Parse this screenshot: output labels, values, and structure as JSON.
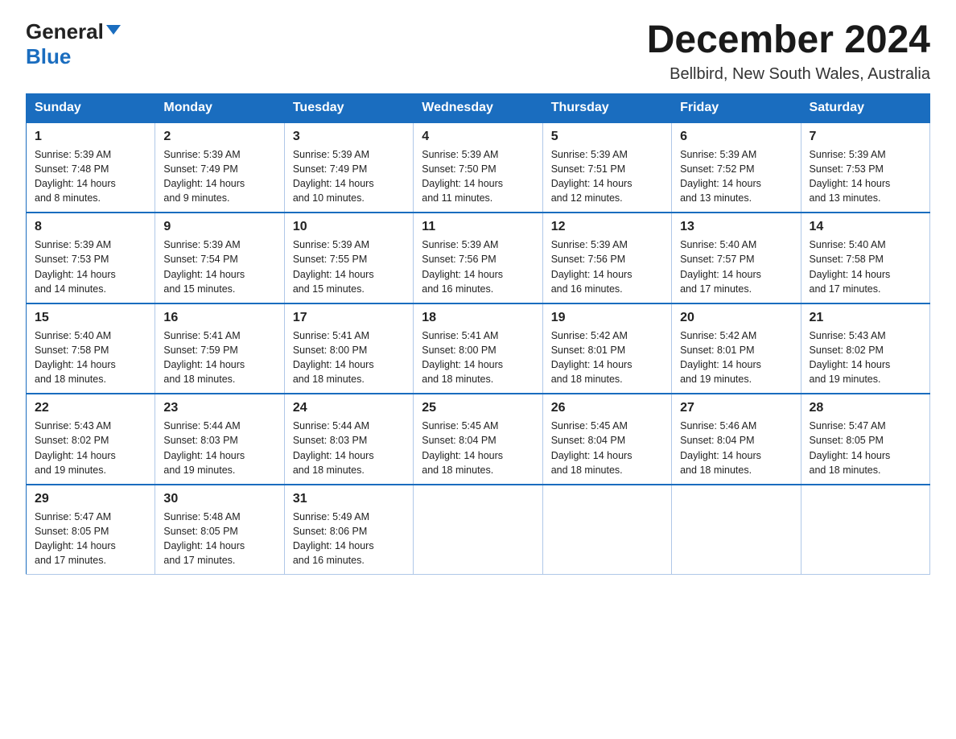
{
  "header": {
    "logo_general": "General",
    "logo_blue": "Blue",
    "title": "December 2024",
    "subtitle": "Bellbird, New South Wales, Australia"
  },
  "weekdays": [
    "Sunday",
    "Monday",
    "Tuesday",
    "Wednesday",
    "Thursday",
    "Friday",
    "Saturday"
  ],
  "weeks": [
    [
      {
        "day": "1",
        "sunrise": "5:39 AM",
        "sunset": "7:48 PM",
        "daylight": "14 hours and 8 minutes."
      },
      {
        "day": "2",
        "sunrise": "5:39 AM",
        "sunset": "7:49 PM",
        "daylight": "14 hours and 9 minutes."
      },
      {
        "day": "3",
        "sunrise": "5:39 AM",
        "sunset": "7:49 PM",
        "daylight": "14 hours and 10 minutes."
      },
      {
        "day": "4",
        "sunrise": "5:39 AM",
        "sunset": "7:50 PM",
        "daylight": "14 hours and 11 minutes."
      },
      {
        "day": "5",
        "sunrise": "5:39 AM",
        "sunset": "7:51 PM",
        "daylight": "14 hours and 12 minutes."
      },
      {
        "day": "6",
        "sunrise": "5:39 AM",
        "sunset": "7:52 PM",
        "daylight": "14 hours and 13 minutes."
      },
      {
        "day": "7",
        "sunrise": "5:39 AM",
        "sunset": "7:53 PM",
        "daylight": "14 hours and 13 minutes."
      }
    ],
    [
      {
        "day": "8",
        "sunrise": "5:39 AM",
        "sunset": "7:53 PM",
        "daylight": "14 hours and 14 minutes."
      },
      {
        "day": "9",
        "sunrise": "5:39 AM",
        "sunset": "7:54 PM",
        "daylight": "14 hours and 15 minutes."
      },
      {
        "day": "10",
        "sunrise": "5:39 AM",
        "sunset": "7:55 PM",
        "daylight": "14 hours and 15 minutes."
      },
      {
        "day": "11",
        "sunrise": "5:39 AM",
        "sunset": "7:56 PM",
        "daylight": "14 hours and 16 minutes."
      },
      {
        "day": "12",
        "sunrise": "5:39 AM",
        "sunset": "7:56 PM",
        "daylight": "14 hours and 16 minutes."
      },
      {
        "day": "13",
        "sunrise": "5:40 AM",
        "sunset": "7:57 PM",
        "daylight": "14 hours and 17 minutes."
      },
      {
        "day": "14",
        "sunrise": "5:40 AM",
        "sunset": "7:58 PM",
        "daylight": "14 hours and 17 minutes."
      }
    ],
    [
      {
        "day": "15",
        "sunrise": "5:40 AM",
        "sunset": "7:58 PM",
        "daylight": "14 hours and 18 minutes."
      },
      {
        "day": "16",
        "sunrise": "5:41 AM",
        "sunset": "7:59 PM",
        "daylight": "14 hours and 18 minutes."
      },
      {
        "day": "17",
        "sunrise": "5:41 AM",
        "sunset": "8:00 PM",
        "daylight": "14 hours and 18 minutes."
      },
      {
        "day": "18",
        "sunrise": "5:41 AM",
        "sunset": "8:00 PM",
        "daylight": "14 hours and 18 minutes."
      },
      {
        "day": "19",
        "sunrise": "5:42 AM",
        "sunset": "8:01 PM",
        "daylight": "14 hours and 18 minutes."
      },
      {
        "day": "20",
        "sunrise": "5:42 AM",
        "sunset": "8:01 PM",
        "daylight": "14 hours and 19 minutes."
      },
      {
        "day": "21",
        "sunrise": "5:43 AM",
        "sunset": "8:02 PM",
        "daylight": "14 hours and 19 minutes."
      }
    ],
    [
      {
        "day": "22",
        "sunrise": "5:43 AM",
        "sunset": "8:02 PM",
        "daylight": "14 hours and 19 minutes."
      },
      {
        "day": "23",
        "sunrise": "5:44 AM",
        "sunset": "8:03 PM",
        "daylight": "14 hours and 19 minutes."
      },
      {
        "day": "24",
        "sunrise": "5:44 AM",
        "sunset": "8:03 PM",
        "daylight": "14 hours and 18 minutes."
      },
      {
        "day": "25",
        "sunrise": "5:45 AM",
        "sunset": "8:04 PM",
        "daylight": "14 hours and 18 minutes."
      },
      {
        "day": "26",
        "sunrise": "5:45 AM",
        "sunset": "8:04 PM",
        "daylight": "14 hours and 18 minutes."
      },
      {
        "day": "27",
        "sunrise": "5:46 AM",
        "sunset": "8:04 PM",
        "daylight": "14 hours and 18 minutes."
      },
      {
        "day": "28",
        "sunrise": "5:47 AM",
        "sunset": "8:05 PM",
        "daylight": "14 hours and 18 minutes."
      }
    ],
    [
      {
        "day": "29",
        "sunrise": "5:47 AM",
        "sunset": "8:05 PM",
        "daylight": "14 hours and 17 minutes."
      },
      {
        "day": "30",
        "sunrise": "5:48 AM",
        "sunset": "8:05 PM",
        "daylight": "14 hours and 17 minutes."
      },
      {
        "day": "31",
        "sunrise": "5:49 AM",
        "sunset": "8:06 PM",
        "daylight": "14 hours and 16 minutes."
      },
      null,
      null,
      null,
      null
    ]
  ],
  "labels": {
    "sunrise": "Sunrise:",
    "sunset": "Sunset:",
    "daylight": "Daylight:"
  }
}
